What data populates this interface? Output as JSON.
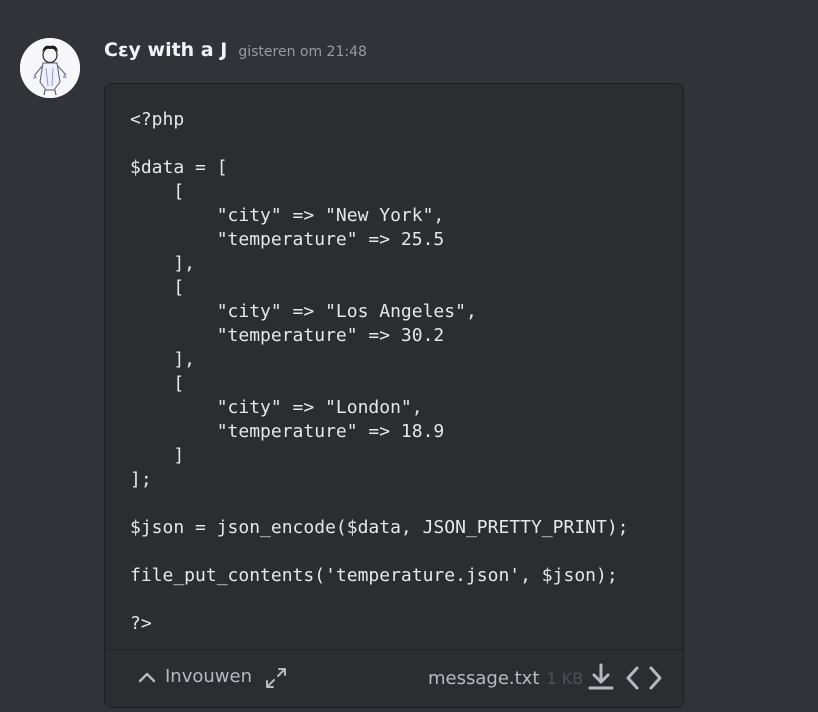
{
  "message": {
    "author": "Cεy with a J",
    "timestamp": "gisteren om 21:48",
    "avatar_icon": "avatar-sketch-icon"
  },
  "attachment": {
    "code": "<?php\n\n$data = [\n    [\n        \"city\" => \"New York\",\n        \"temperature\" => 25.5\n    ],\n    [\n        \"city\" => \"Los Angeles\",\n        \"temperature\" => 30.2\n    ],\n    [\n        \"city\" => \"London\",\n        \"temperature\" => 18.9\n    ]\n];\n\n$json = json_encode($data, JSON_PRETTY_PRINT);\n\nfile_put_contents('temperature.json', $json);\n\n?>",
    "collapse_label": "Invouwen",
    "file_name": "message.txt",
    "file_size": "1 KB",
    "icons": {
      "collapse": "chevron-up-icon",
      "expand": "expand-arrows-icon",
      "download": "download-icon",
      "view_code": "code-brackets-icon"
    }
  },
  "colors": {
    "background": "#313338",
    "card": "#2b2d31",
    "text": "#e6e7e9",
    "muted": "#949ba4"
  }
}
